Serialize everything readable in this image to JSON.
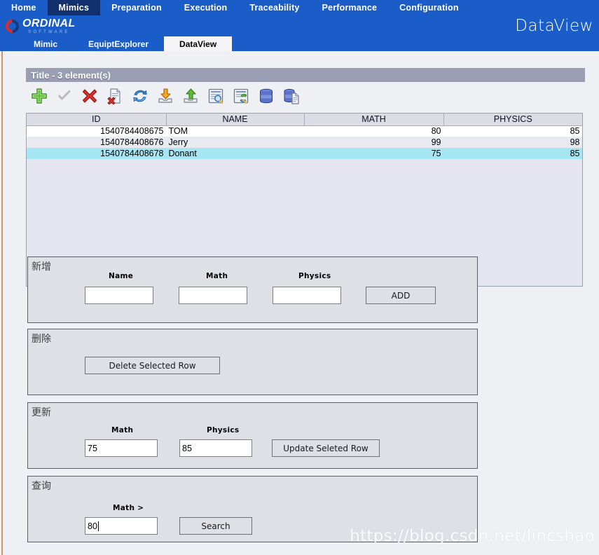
{
  "header": {
    "app_title": "DataView",
    "logo_name": "ORDINAL",
    "logo_sub": "SOFTWARE",
    "nav_items": [
      {
        "label": "Home",
        "active": false
      },
      {
        "label": "Mimics",
        "active": true
      },
      {
        "label": "Preparation",
        "active": false
      },
      {
        "label": "Execution",
        "active": false
      },
      {
        "label": "Traceability",
        "active": false
      },
      {
        "label": "Performance",
        "active": false
      },
      {
        "label": "Configuration",
        "active": false
      }
    ],
    "sub_tabs": [
      {
        "label": "Mimic",
        "active": false
      },
      {
        "label": "EquiptExplorer",
        "active": false
      },
      {
        "label": "DataView",
        "active": true
      }
    ]
  },
  "panel": {
    "title": "Title - 3 element(s)",
    "toolbar": [
      {
        "name": "add-icon",
        "title": "Add"
      },
      {
        "name": "validate-check-icon",
        "title": "Validate"
      },
      {
        "name": "delete-icon",
        "title": "Delete"
      },
      {
        "name": "delete-document-icon",
        "title": "Delete document"
      },
      {
        "name": "refresh-icon",
        "title": "Refresh"
      },
      {
        "name": "import-icon",
        "title": "Import"
      },
      {
        "name": "export-icon",
        "title": "Export"
      },
      {
        "name": "search-document-icon",
        "title": "Search document"
      },
      {
        "name": "refresh-query-icon",
        "title": "Refresh query"
      },
      {
        "name": "database-icon",
        "title": "Database"
      },
      {
        "name": "database-document-icon",
        "title": "Database document"
      }
    ]
  },
  "table": {
    "columns": [
      "ID",
      "NAME",
      "MATH",
      "PHYSICS"
    ],
    "rows": [
      {
        "id": "1540784408675",
        "name": "TOM",
        "math": "80",
        "physics": "85",
        "selected": false
      },
      {
        "id": "1540784408676",
        "name": "Jerry",
        "math": "99",
        "physics": "98",
        "selected": false
      },
      {
        "id": "1540784408678",
        "name": "Donant",
        "math": "75",
        "physics": "85",
        "selected": true
      }
    ]
  },
  "add_section": {
    "legend": "新增",
    "name_label": "Name",
    "math_label": "Math",
    "physics_label": "Physics",
    "name_value": "",
    "math_value": "",
    "physics_value": "",
    "button_label": "ADD"
  },
  "delete_section": {
    "legend": "删除",
    "button_label": "Delete Selected Row"
  },
  "update_section": {
    "legend": "更新",
    "math_label": "Math",
    "physics_label": "Physics",
    "math_value": "75",
    "physics_value": "85",
    "button_label": "Update Seleted Row"
  },
  "query_section": {
    "legend": "查询",
    "math_label": "Math >",
    "math_value": "80",
    "button_label": "Search"
  },
  "watermark": "https://blog.csdn.net/lincshao",
  "colors": {
    "nav_blue": "#1a5cc8",
    "nav_active": "#12306b",
    "panel_header": "#9a9eb3",
    "row_selected": "#a5e6f2",
    "accent_stripe": "#d79355"
  }
}
